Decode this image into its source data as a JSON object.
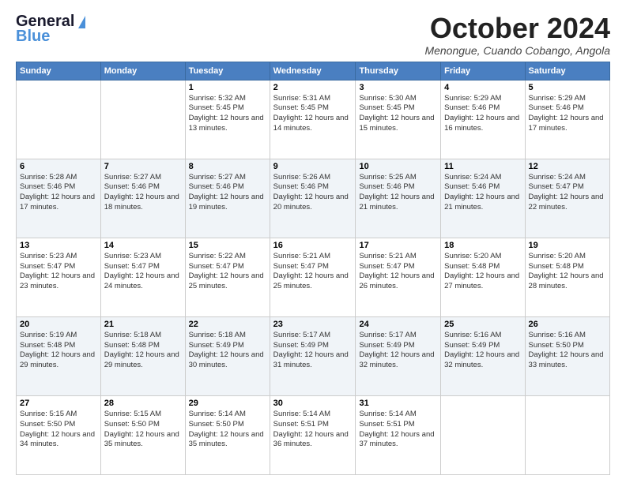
{
  "header": {
    "logo_general": "General",
    "logo_blue": "Blue",
    "month_title": "October 2024",
    "location": "Menongue, Cuando Cobango, Angola"
  },
  "days_of_week": [
    "Sunday",
    "Monday",
    "Tuesday",
    "Wednesday",
    "Thursday",
    "Friday",
    "Saturday"
  ],
  "weeks": [
    [
      {
        "day": "",
        "sunrise": "",
        "sunset": "",
        "daylight": ""
      },
      {
        "day": "",
        "sunrise": "",
        "sunset": "",
        "daylight": ""
      },
      {
        "day": "1",
        "sunrise": "Sunrise: 5:32 AM",
        "sunset": "Sunset: 5:45 PM",
        "daylight": "Daylight: 12 hours and 13 minutes."
      },
      {
        "day": "2",
        "sunrise": "Sunrise: 5:31 AM",
        "sunset": "Sunset: 5:45 PM",
        "daylight": "Daylight: 12 hours and 14 minutes."
      },
      {
        "day": "3",
        "sunrise": "Sunrise: 5:30 AM",
        "sunset": "Sunset: 5:45 PM",
        "daylight": "Daylight: 12 hours and 15 minutes."
      },
      {
        "day": "4",
        "sunrise": "Sunrise: 5:29 AM",
        "sunset": "Sunset: 5:46 PM",
        "daylight": "Daylight: 12 hours and 16 minutes."
      },
      {
        "day": "5",
        "sunrise": "Sunrise: 5:29 AM",
        "sunset": "Sunset: 5:46 PM",
        "daylight": "Daylight: 12 hours and 17 minutes."
      }
    ],
    [
      {
        "day": "6",
        "sunrise": "Sunrise: 5:28 AM",
        "sunset": "Sunset: 5:46 PM",
        "daylight": "Daylight: 12 hours and 17 minutes."
      },
      {
        "day": "7",
        "sunrise": "Sunrise: 5:27 AM",
        "sunset": "Sunset: 5:46 PM",
        "daylight": "Daylight: 12 hours and 18 minutes."
      },
      {
        "day": "8",
        "sunrise": "Sunrise: 5:27 AM",
        "sunset": "Sunset: 5:46 PM",
        "daylight": "Daylight: 12 hours and 19 minutes."
      },
      {
        "day": "9",
        "sunrise": "Sunrise: 5:26 AM",
        "sunset": "Sunset: 5:46 PM",
        "daylight": "Daylight: 12 hours and 20 minutes."
      },
      {
        "day": "10",
        "sunrise": "Sunrise: 5:25 AM",
        "sunset": "Sunset: 5:46 PM",
        "daylight": "Daylight: 12 hours and 21 minutes."
      },
      {
        "day": "11",
        "sunrise": "Sunrise: 5:24 AM",
        "sunset": "Sunset: 5:46 PM",
        "daylight": "Daylight: 12 hours and 21 minutes."
      },
      {
        "day": "12",
        "sunrise": "Sunrise: 5:24 AM",
        "sunset": "Sunset: 5:47 PM",
        "daylight": "Daylight: 12 hours and 22 minutes."
      }
    ],
    [
      {
        "day": "13",
        "sunrise": "Sunrise: 5:23 AM",
        "sunset": "Sunset: 5:47 PM",
        "daylight": "Daylight: 12 hours and 23 minutes."
      },
      {
        "day": "14",
        "sunrise": "Sunrise: 5:23 AM",
        "sunset": "Sunset: 5:47 PM",
        "daylight": "Daylight: 12 hours and 24 minutes."
      },
      {
        "day": "15",
        "sunrise": "Sunrise: 5:22 AM",
        "sunset": "Sunset: 5:47 PM",
        "daylight": "Daylight: 12 hours and 25 minutes."
      },
      {
        "day": "16",
        "sunrise": "Sunrise: 5:21 AM",
        "sunset": "Sunset: 5:47 PM",
        "daylight": "Daylight: 12 hours and 25 minutes."
      },
      {
        "day": "17",
        "sunrise": "Sunrise: 5:21 AM",
        "sunset": "Sunset: 5:47 PM",
        "daylight": "Daylight: 12 hours and 26 minutes."
      },
      {
        "day": "18",
        "sunrise": "Sunrise: 5:20 AM",
        "sunset": "Sunset: 5:48 PM",
        "daylight": "Daylight: 12 hours and 27 minutes."
      },
      {
        "day": "19",
        "sunrise": "Sunrise: 5:20 AM",
        "sunset": "Sunset: 5:48 PM",
        "daylight": "Daylight: 12 hours and 28 minutes."
      }
    ],
    [
      {
        "day": "20",
        "sunrise": "Sunrise: 5:19 AM",
        "sunset": "Sunset: 5:48 PM",
        "daylight": "Daylight: 12 hours and 29 minutes."
      },
      {
        "day": "21",
        "sunrise": "Sunrise: 5:18 AM",
        "sunset": "Sunset: 5:48 PM",
        "daylight": "Daylight: 12 hours and 29 minutes."
      },
      {
        "day": "22",
        "sunrise": "Sunrise: 5:18 AM",
        "sunset": "Sunset: 5:49 PM",
        "daylight": "Daylight: 12 hours and 30 minutes."
      },
      {
        "day": "23",
        "sunrise": "Sunrise: 5:17 AM",
        "sunset": "Sunset: 5:49 PM",
        "daylight": "Daylight: 12 hours and 31 minutes."
      },
      {
        "day": "24",
        "sunrise": "Sunrise: 5:17 AM",
        "sunset": "Sunset: 5:49 PM",
        "daylight": "Daylight: 12 hours and 32 minutes."
      },
      {
        "day": "25",
        "sunrise": "Sunrise: 5:16 AM",
        "sunset": "Sunset: 5:49 PM",
        "daylight": "Daylight: 12 hours and 32 minutes."
      },
      {
        "day": "26",
        "sunrise": "Sunrise: 5:16 AM",
        "sunset": "Sunset: 5:50 PM",
        "daylight": "Daylight: 12 hours and 33 minutes."
      }
    ],
    [
      {
        "day": "27",
        "sunrise": "Sunrise: 5:15 AM",
        "sunset": "Sunset: 5:50 PM",
        "daylight": "Daylight: 12 hours and 34 minutes."
      },
      {
        "day": "28",
        "sunrise": "Sunrise: 5:15 AM",
        "sunset": "Sunset: 5:50 PM",
        "daylight": "Daylight: 12 hours and 35 minutes."
      },
      {
        "day": "29",
        "sunrise": "Sunrise: 5:14 AM",
        "sunset": "Sunset: 5:50 PM",
        "daylight": "Daylight: 12 hours and 35 minutes."
      },
      {
        "day": "30",
        "sunrise": "Sunrise: 5:14 AM",
        "sunset": "Sunset: 5:51 PM",
        "daylight": "Daylight: 12 hours and 36 minutes."
      },
      {
        "day": "31",
        "sunrise": "Sunrise: 5:14 AM",
        "sunset": "Sunset: 5:51 PM",
        "daylight": "Daylight: 12 hours and 37 minutes."
      },
      {
        "day": "",
        "sunrise": "",
        "sunset": "",
        "daylight": ""
      },
      {
        "day": "",
        "sunrise": "",
        "sunset": "",
        "daylight": ""
      }
    ]
  ]
}
